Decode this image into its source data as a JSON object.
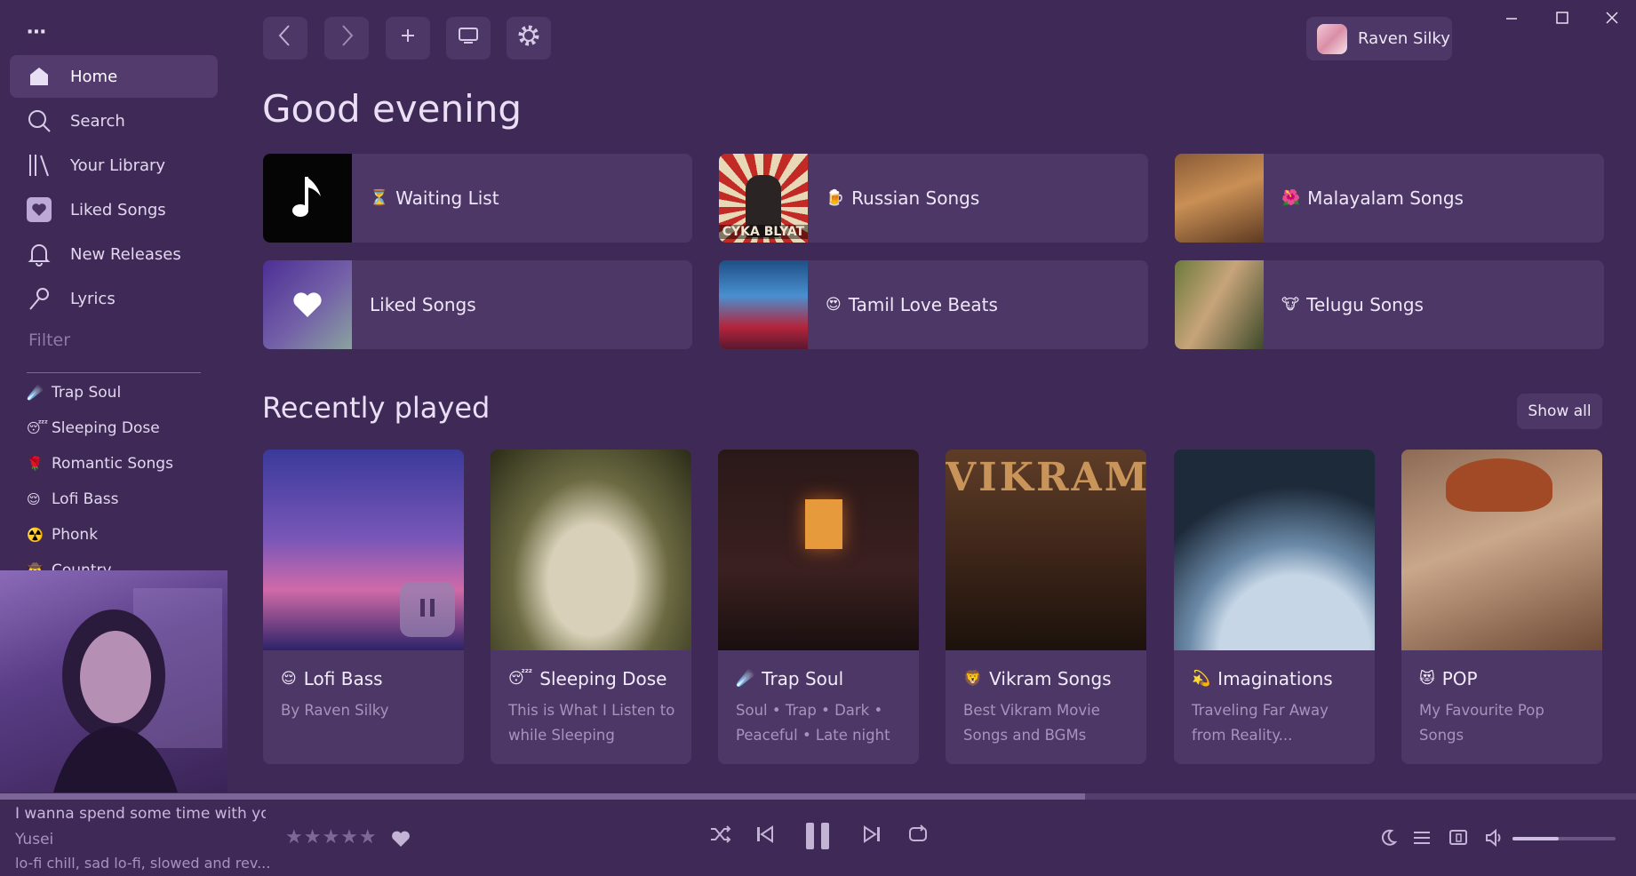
{
  "window": {
    "controls": [
      "minimize",
      "maximize",
      "close"
    ]
  },
  "sidebar": {
    "menu_icon": "⋯",
    "nav": [
      {
        "label": "Home",
        "icon": "home-icon",
        "active": true
      },
      {
        "label": "Search",
        "icon": "search-icon"
      },
      {
        "label": "Your Library",
        "icon": "library-icon"
      },
      {
        "label": "Liked Songs",
        "icon": "heart-icon"
      },
      {
        "label": "New Releases",
        "icon": "bell-icon"
      },
      {
        "label": "Lyrics",
        "icon": "microphone-icon"
      }
    ],
    "filter_placeholder": "Filter",
    "playlists": [
      {
        "emoji": "☄️",
        "label": "Trap Soul"
      },
      {
        "emoji": "😴",
        "label": "Sleeping Dose"
      },
      {
        "emoji": "🌹",
        "label": "Romantic Songs"
      },
      {
        "emoji": "😌",
        "label": "Lofi Bass"
      },
      {
        "emoji": "☢️",
        "label": "Phonk"
      },
      {
        "emoji": "🤠",
        "label": "Country"
      }
    ]
  },
  "toolbar": {
    "user_name": "Raven Silky"
  },
  "main": {
    "greeting": "Good evening",
    "quick": [
      {
        "emoji": "⏳",
        "label": "Waiting List"
      },
      {
        "emoji": "🍺",
        "label": "Russian Songs",
        "art_text": "CYKA BLYAT"
      },
      {
        "emoji": "🌺",
        "label": "Malayalam Songs"
      },
      {
        "emoji": "",
        "label": "Liked Songs"
      },
      {
        "emoji": "😍",
        "label": "Tamil Love Beats"
      },
      {
        "emoji": "🐮",
        "label": "Telugu Songs"
      }
    ],
    "recent_title": "Recently played",
    "show_all": "Show all",
    "cards": [
      {
        "emoji": "😌",
        "title": "Lofi Bass",
        "sub": "By Raven Silky"
      },
      {
        "emoji": "😴",
        "title": "Sleeping Dose",
        "sub": "This is What I Listen to while Sleeping"
      },
      {
        "emoji": "☄️",
        "title": "Trap Soul",
        "sub": "Soul • Trap • Dark • Peaceful • Late night"
      },
      {
        "emoji": "🦁",
        "title": "Vikram Songs",
        "sub": "Best Vikram Movie Songs and BGMs",
        "art_text": "VIKRAM"
      },
      {
        "emoji": "💫",
        "title": "Imaginations",
        "sub": "Traveling Far Away from Reality..."
      },
      {
        "emoji": "😻",
        "title": "POP",
        "sub": "My Favourite Pop Songs"
      }
    ]
  },
  "player": {
    "lyric": "I wanna spend some time with you",
    "artist": "Yusei",
    "tags": "lo-fi chill, sad lo-fi, slowed and rev...",
    "rating_stars": "★★★★★",
    "progress": 0.663,
    "volume": 0.45
  },
  "colors": {
    "bg": "#3f2a57",
    "surface": "#4d3766",
    "accent": "#7c6599"
  }
}
